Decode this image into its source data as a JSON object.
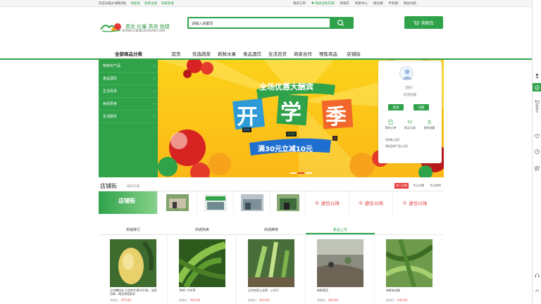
{
  "topbar": {
    "left": [
      "欢迎光临乡城网(钢)",
      "请登录",
      "免费注册",
      "商家登录"
    ],
    "right": [
      "我的订单",
      "♥ 我关注的店铺",
      "购物车",
      "商家中心",
      "微信端",
      "手机端",
      "网站导航"
    ]
  },
  "logo": {
    "slogan": "质优 价廉 高效 快捷",
    "url": "XIANGCHENGZAIXIAN.COM"
  },
  "search": {
    "value": "请输入关键词"
  },
  "cart_label": "购物车",
  "nav": {
    "all_label": "全部商品分类",
    "items": [
      "首页",
      "优选蔬菜",
      "新鲜水果",
      "食品酒饮",
      "生活百货",
      "商家合作",
      "预售商品",
      "店铺街"
    ]
  },
  "categories": [
    "特色农产品",
    "食品酒饮",
    "生活百货",
    "休闲零食",
    "生活服务"
  ],
  "banner": {
    "tagline": "全场优惠大酬宾",
    "big": [
      "开",
      "学",
      "季"
    ],
    "pinyin": [
      "kai",
      "xue",
      "ji"
    ],
    "promo": "满30元立减10元"
  },
  "userbox": {
    "greeting": "您好！",
    "welcome": "欢迎光临",
    "login": "登录",
    "register": "注册",
    "icons": [
      "我的订单",
      "购买记录",
      "我的收藏"
    ],
    "notices": [
      "【系统公告】",
      "【新品农产品公告】"
    ]
  },
  "street": {
    "title": "店铺街",
    "subtitle": "推荐店铺",
    "tags": [
      "热门店铺",
      "今日大牌",
      "今日特供"
    ],
    "banner_text": "店铺街",
    "vacant": "虚位以待"
  },
  "tabs": [
    "热销排行",
    "商城热卖",
    "商城推荐",
    "新品上市",
    ""
  ],
  "products": [
    {
      "name": "正宗攀枝花 大凯特芒果10斤装，全国包邮，精品果园直发",
      "price_label": "商城价：",
      "price": "¥75.00"
    },
    {
      "name": "'鲜的' 竹竿笋",
      "price_label": "商城价：",
      "price": "¥10.00"
    },
    {
      "name": "正宗农家土苦笋，小半斤",
      "price_label": "商城价：",
      "price": "¥10.00"
    },
    {
      "name": "新鲜莴苣",
      "price_label": "商城价：",
      "price": "¥10.00"
    },
    {
      "name": "新鲜有花椒",
      "price_label": "商城价：",
      "price": "¥45.00"
    }
  ],
  "sidebar": {
    "cart": "购物车"
  },
  "colors": {
    "brand": "#2fa24a",
    "price": "#e53935",
    "banner": "#fcd21c"
  }
}
